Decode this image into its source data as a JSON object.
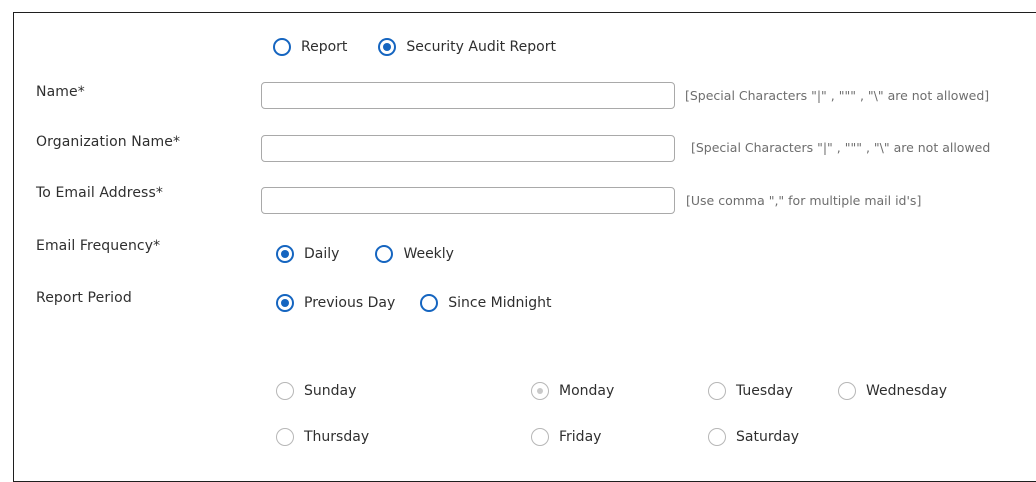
{
  "report_type": {
    "options": [
      "Report",
      "Security Audit Report"
    ],
    "selected": "Security Audit Report"
  },
  "fields": {
    "name": {
      "label": "Name*",
      "value": "",
      "hint": "[Special Characters \"|\" , \"\"\" , \"\\\" are not allowed]"
    },
    "organization": {
      "label": "Organization Name*",
      "value": "",
      "hint": "[Special Characters \"|\" , \"\"\" , \"\\\" are not allowed"
    },
    "email": {
      "label": "To Email Address*",
      "value": "",
      "hint": "[Use comma \",\" for multiple mail id's]"
    }
  },
  "email_frequency": {
    "label": "Email Frequency*",
    "options": [
      "Daily",
      "Weekly"
    ],
    "selected": "Daily"
  },
  "report_period": {
    "label": "Report Period",
    "options": [
      "Previous Day",
      "Since Midnight"
    ],
    "selected": "Previous Day"
  },
  "weekdays": {
    "options": [
      "Sunday",
      "Monday",
      "Tuesday",
      "Wednesday",
      "Thursday",
      "Friday",
      "Saturday"
    ],
    "selected": "Monday",
    "disabled": true
  },
  "colors": {
    "accent": "#1565c0",
    "disabled": "#b7b7b7",
    "hint_text": "#6e6e6e"
  }
}
